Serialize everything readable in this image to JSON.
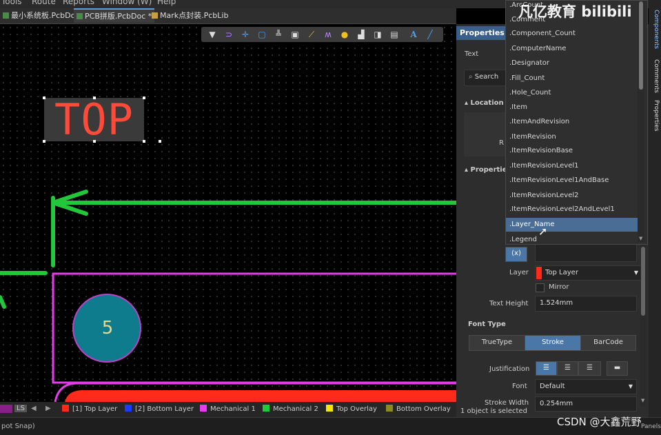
{
  "menubar": {
    "items": [
      "Tools",
      "Route",
      "Reports",
      "Window (W)",
      "Help"
    ]
  },
  "tabs": [
    {
      "label": "最小系统板.PcbDoc",
      "icon": "pcb-doc-icon",
      "active": false
    },
    {
      "label": "PCB拼版.PcbDoc *",
      "icon": "pcb-doc-icon",
      "active": true
    },
    {
      "label": "Mark点封装.PcbLib",
      "icon": "pcb-lib-icon",
      "active": false
    }
  ],
  "toolbar": {
    "icons": [
      "filter-icon",
      "route-icon",
      "cross-icon",
      "select-rect-icon",
      "align-icon",
      "component-icon",
      "interactive-route-icon",
      "arc-icon",
      "via-icon",
      "fill-icon",
      "region-icon",
      "graph-icon",
      "text-icon",
      "line-icon"
    ]
  },
  "canvas": {
    "text_object": "TOP",
    "pad_number": "5"
  },
  "properties": {
    "title": "Properties",
    "object_type": "Text",
    "search_placeholder": "Search",
    "section_location": "Location",
    "location_stub": "R",
    "section_properties": "Properties",
    "layer_label": "Layer",
    "layer_value": "Top Layer",
    "mirror_label": "Mirror",
    "text_height_label": "Text Height",
    "text_height_value": "1.524mm",
    "font_type_header": "Font Type",
    "font_types": [
      "TrueType",
      "Stroke",
      "BarCode"
    ],
    "active_font_type": "Stroke",
    "justification_label": "Justification",
    "font_label": "Font",
    "font_value": "Default",
    "stroke_width_label": "Stroke Width",
    "stroke_width_value": "0.254mm",
    "selection_status": "1 object is selected",
    "fx_button": "(x)"
  },
  "dropdown": {
    "items": [
      ".ArcCount",
      ".Comment",
      ".Component_Count",
      ".ComputerName",
      ".Designator",
      ".Fill_Count",
      ".Hole_Count",
      ".Item",
      ".ItemAndRevision",
      ".ItemRevision",
      ".ItemRevisionBase",
      ".ItemRevisionLevel1",
      ".ItemRevisionLevel1AndBase",
      ".ItemRevisionLevel2",
      ".ItemRevisionLevel2AndLevel1",
      ".Layer_Name",
      ".Legend"
    ],
    "selected": ".Layer_Name"
  },
  "side_tabs": [
    "Components",
    "Comments",
    "Properties"
  ],
  "layers": [
    {
      "label": "LS",
      "color": ""
    },
    {
      "label": "[1] Top Layer",
      "color": "#ff2a1a"
    },
    {
      "label": "[2] Bottom Layer",
      "color": "#1a3cff"
    },
    {
      "label": "Mechanical 1",
      "color": "#e83cf0"
    },
    {
      "label": "Mechanical 2",
      "color": "#22c83a"
    },
    {
      "label": "Top Overlay",
      "color": "#f5e60a"
    },
    {
      "label": "Bottom Overlay",
      "color": "#8a8a1e"
    }
  ],
  "statusbar": {
    "left_text": "pot Snap)",
    "right_text": "Panels"
  },
  "watermarks": {
    "top": "凡亿教育 bilibili",
    "bottom": "CSDN @大鑫荒野"
  },
  "colors": {
    "accent": "#4a76a8",
    "board_outline": "#e83cf0",
    "route": "#22c83a",
    "pad": "#0e7c8c",
    "top_text": "#ff4a3a"
  }
}
